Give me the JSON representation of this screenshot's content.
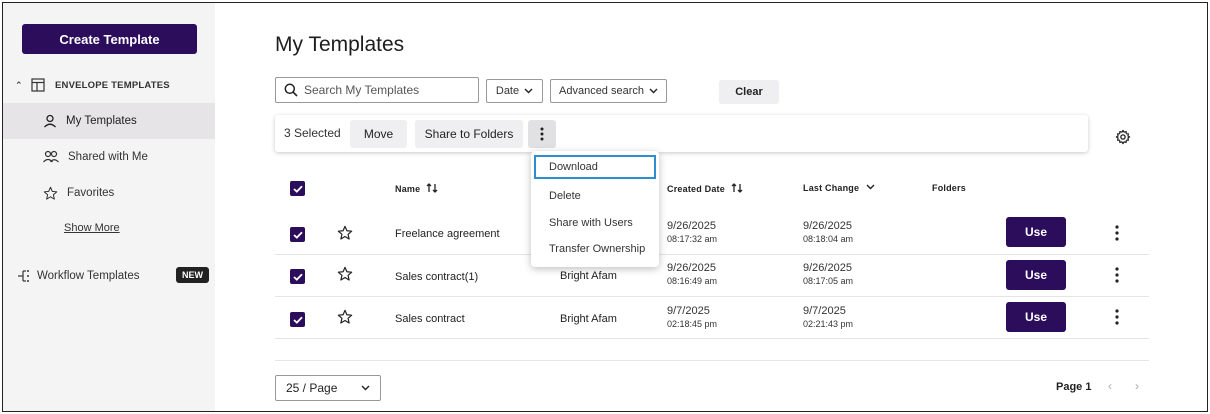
{
  "sidebar": {
    "create_label": "Create Template",
    "envelope_header": "ENVELOPE TEMPLATES",
    "items": [
      {
        "label": "My Templates"
      },
      {
        "label": "Shared with Me"
      },
      {
        "label": "Favorites"
      }
    ],
    "show_more": "Show More",
    "workflow_label": "Workflow Templates",
    "new_badge": "NEW"
  },
  "main": {
    "title": "My Templates",
    "search_placeholder": "Search My Templates",
    "date_filter": "Date",
    "advanced_search": "Advanced search",
    "clear_label": "Clear",
    "selected_count": "3 Selected",
    "move_label": "Move",
    "share_folders_label": "Share to Folders"
  },
  "dropdown": {
    "items": [
      "Download",
      "Delete",
      "Share with Users",
      "Transfer Ownership"
    ]
  },
  "table": {
    "headers": {
      "name": "Name",
      "created": "Created Date",
      "changed": "Last Change",
      "folders": "Folders"
    },
    "use_label": "Use",
    "rows": [
      {
        "name": "Freelance agreement",
        "owner": "",
        "created_date": "9/26/2025",
        "created_time": "08:17:32 am",
        "changed_date": "9/26/2025",
        "changed_time": "08:18:04 am"
      },
      {
        "name": "Sales contract(1)",
        "owner": "Bright Afam",
        "created_date": "9/26/2025",
        "created_time": "08:16:49 am",
        "changed_date": "9/26/2025",
        "changed_time": "08:17:05 am"
      },
      {
        "name": "Sales contract",
        "owner": "Bright Afam",
        "created_date": "9/7/2025",
        "created_time": "02:18:45 pm",
        "changed_date": "9/7/2025",
        "changed_time": "02:21:43 pm"
      }
    ]
  },
  "footer": {
    "page_size": "25 / Page",
    "page_label": "Page 1"
  },
  "colors": {
    "brand": "#2c0d5c",
    "focus": "#2e8fd0"
  }
}
